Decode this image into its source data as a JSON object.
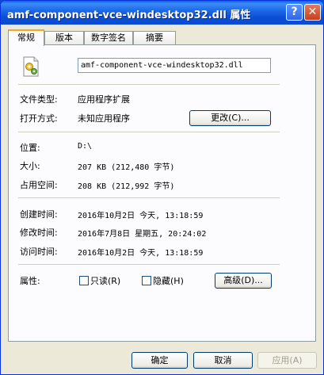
{
  "window": {
    "title": "amf-component-vce-windesktop32.dll 属性"
  },
  "titlebar": {
    "help_label": "?",
    "close_label": "✕"
  },
  "tabs": [
    {
      "label": "常规",
      "active": true
    },
    {
      "label": "版本",
      "active": false
    },
    {
      "label": "数字签名",
      "active": false
    },
    {
      "label": "摘要",
      "active": false
    }
  ],
  "file": {
    "name": "amf-component-vce-windesktop32.dll",
    "icon": "dll-file-icon"
  },
  "info": {
    "type_label": "文件类型:",
    "type_value": "应用程序扩展",
    "open_label": "打开方式:",
    "open_value": "未知应用程序",
    "change_button": "更改(C)...",
    "location_label": "位置:",
    "location_value": "D:\\",
    "size_label": "大小:",
    "size_value": "207 KB (212,480 字节)",
    "disk_label": "占用空间:",
    "disk_value": "208 KB (212,992 字节)",
    "created_label": "创建时间:",
    "created_value": "2016年10月2日 今天, 13:18:59",
    "modified_label": "修改时间:",
    "modified_value": "2016年7月8日 星期五, 20:24:02",
    "accessed_label": "访问时间:",
    "accessed_value": "2016年10月2日 今天, 13:18:59"
  },
  "attributes": {
    "label": "属性:",
    "readonly": {
      "label": "只读(R)",
      "checked": false
    },
    "hidden": {
      "label": "隐藏(H)",
      "checked": false
    },
    "advanced_button": "高级(D)..."
  },
  "footer": {
    "ok": "确定",
    "cancel": "取消",
    "apply": "应用(A)"
  }
}
